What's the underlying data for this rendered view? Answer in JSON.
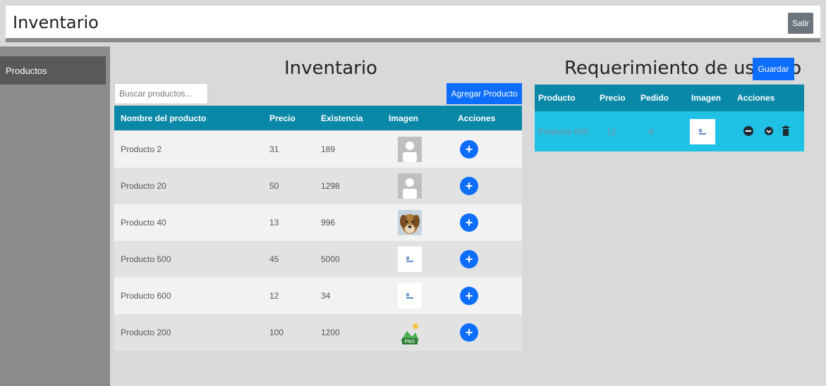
{
  "app": {
    "title": "Inventario",
    "logout_label": "Salir"
  },
  "sidebar": {
    "items": [
      {
        "label": "Productos"
      }
    ]
  },
  "inventory": {
    "title": "Inventario",
    "search_placeholder": "Buscar productos...",
    "add_label": "Agregar Producto",
    "columns": [
      "Nombre del producto",
      "Precio",
      "Existencia",
      "Imagen",
      "Acciones"
    ],
    "rows": [
      {
        "name": "Producto 2",
        "price": "31",
        "stock": "189",
        "image": "user-placeholder"
      },
      {
        "name": "Producto 20",
        "price": "50",
        "stock": "1298",
        "image": "user-placeholder"
      },
      {
        "name": "Producto 40",
        "price": "13",
        "stock": "996",
        "image": "dog-photo"
      },
      {
        "name": "Producto 500",
        "price": "45",
        "stock": "5000",
        "image": "broken-image"
      },
      {
        "name": "Producto 600",
        "price": "12",
        "stock": "34",
        "image": "broken-image"
      },
      {
        "name": "Producto 200",
        "price": "100",
        "stock": "1200",
        "image": "png-file-icon"
      }
    ],
    "row_action_icon": "plus-icon"
  },
  "requirement": {
    "title": "Requerimiento de usuario",
    "save_label": "Guardar",
    "columns": [
      "Producto",
      "Precio",
      "Pedido",
      "Imagen",
      "Acciones"
    ],
    "rows": [
      {
        "name": "Producto 600",
        "price": "12",
        "ordered": "6",
        "image": "broken-image",
        "actions": [
          "minus-circle-icon",
          "chevron-down-circle-icon",
          "trash-icon"
        ]
      }
    ]
  },
  "colors": {
    "header_teal": "#0a88a8",
    "selected_row": "#1fc1e4",
    "primary": "#0d6efd",
    "sidebar": "#8b8b8b"
  }
}
